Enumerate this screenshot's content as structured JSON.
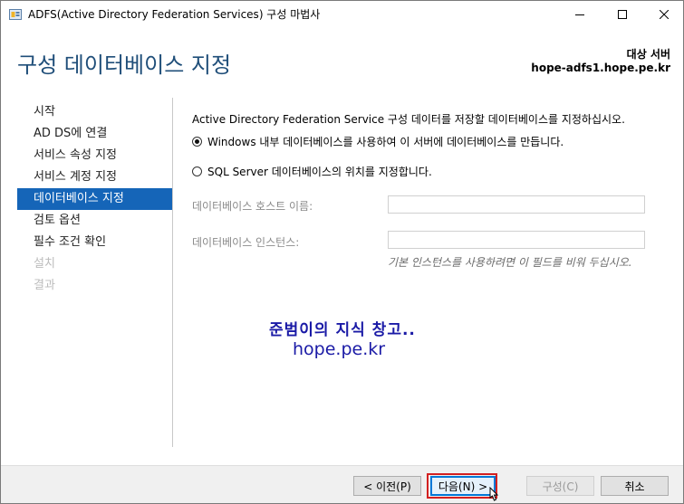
{
  "window": {
    "title": "ADFS(Active Directory Federation Services) 구성 마법사",
    "icons": {
      "app": "adfs-app-icon",
      "minimize": "minimize-icon",
      "maximize": "maximize-icon",
      "close": "close-icon"
    }
  },
  "header": {
    "page_title": "구성 데이터베이스 지정",
    "target_label": "대상 서버",
    "target_server": "hope-adfs1.hope.pe.kr"
  },
  "nav": {
    "items": [
      {
        "label": "시작",
        "state": "normal"
      },
      {
        "label": "AD DS에 연결",
        "state": "normal"
      },
      {
        "label": "서비스 속성 지정",
        "state": "normal"
      },
      {
        "label": "서비스 계정 지정",
        "state": "normal"
      },
      {
        "label": "데이터베이스 지정",
        "state": "selected"
      },
      {
        "label": "검토 옵션",
        "state": "normal"
      },
      {
        "label": "필수 조건 확인",
        "state": "normal"
      },
      {
        "label": "설치",
        "state": "disabled"
      },
      {
        "label": "결과",
        "state": "disabled"
      }
    ]
  },
  "main": {
    "description": "Active Directory Federation Service 구성 데이터를 저장할 데이터베이스를 지정하십시오.",
    "options": [
      {
        "label": "Windows 내부 데이터베이스를 사용하여 이 서버에 데이터베이스를 만듭니다.",
        "checked": true
      },
      {
        "label": "SQL Server 데이터베이스의 위치를 지정합니다.",
        "checked": false
      }
    ],
    "fields": {
      "host_label": "데이터베이스 호스트 이름:",
      "host_value": "",
      "instance_label": "데이터베이스 인스턴스:",
      "instance_value": "",
      "instance_hint": "기본 인스턴스를 사용하려면 이 필드를 비워 두십시오."
    }
  },
  "watermark": {
    "line1": "준범이의 지식 창고..",
    "line2": "hope.pe.kr"
  },
  "footer": {
    "prev_label": "< 이전(P)",
    "next_label": "다음(N) >",
    "configure_label": "구성(C)",
    "cancel_label": "취소"
  },
  "colors": {
    "accent": "#1565b8",
    "title": "#1f4e79",
    "highlight": "#d32020",
    "watermark": "#1a1aa6"
  }
}
